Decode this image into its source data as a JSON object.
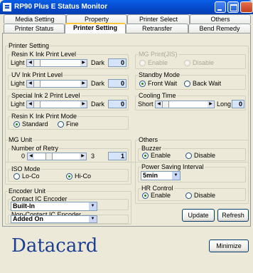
{
  "window": {
    "title": "RP90 Plus E  Status Monitor"
  },
  "tabs": {
    "row1": [
      "Media Setting",
      "Property",
      "Printer Select",
      "Others"
    ],
    "row2": [
      "Printer Status",
      "Printer Setting",
      "Retransfer",
      "Bend Remedy"
    ],
    "active": "Printer Setting"
  },
  "printer_setting": {
    "legend": "Printer Setting",
    "resin": {
      "title": "Resin K Ink Print Level",
      "min_label": "Light",
      "max_label": "Dark",
      "value": "0"
    },
    "uv": {
      "title": "UV Ink Print Level",
      "min_label": "Light",
      "max_label": "Dark",
      "value": "0"
    },
    "special": {
      "title": "Special Ink 2 Print Level",
      "min_label": "Light",
      "max_label": "Dark",
      "value": "0"
    },
    "print_mode": {
      "title": "Resin K Ink Print Mode",
      "options": [
        "Standard",
        "Fine"
      ],
      "selected": "Standard"
    },
    "mg_print": {
      "title": "MG Print(JIS)",
      "options": [
        "Enable",
        "Disable"
      ],
      "disabled": true
    },
    "standby": {
      "title": "Standby Mode",
      "options": [
        "Front Wait",
        "Back Wait"
      ],
      "selected": "Front Wait"
    },
    "cooling": {
      "title": "Cooling Time",
      "min_label": "Short",
      "max_label": "Long",
      "value": "0"
    }
  },
  "mg_unit": {
    "legend": "MG Unit",
    "retry": {
      "title": "Number of Retry",
      "min_label": "0",
      "max_label": "3",
      "value": "1"
    },
    "iso_mode": {
      "title": "ISO Mode",
      "options": [
        "Lo-Co",
        "Hi-Co"
      ],
      "selected": "Hi-Co"
    }
  },
  "encoder_unit": {
    "legend": "Encoder Unit",
    "contact": {
      "title": "Contact IC Encoder",
      "value": "Built-In"
    },
    "noncontact": {
      "title": "Non-Contact IC Encoder",
      "value": "Added On"
    }
  },
  "others": {
    "legend": "Others",
    "buzzer": {
      "title": "Buzzer",
      "options": [
        "Enable",
        "Disable"
      ],
      "selected": "Enable"
    },
    "power_saving": {
      "title": "Power Saving Interval",
      "value": "5min"
    },
    "hr_control": {
      "title": "HR Control",
      "options": [
        "Enable",
        "Disable"
      ],
      "selected": "Enable"
    }
  },
  "buttons": {
    "update": "Update",
    "refresh": "Refresh",
    "minimize": "Minimize"
  },
  "brand": {
    "logo": "Datacard",
    "color": "#1C3F94"
  }
}
